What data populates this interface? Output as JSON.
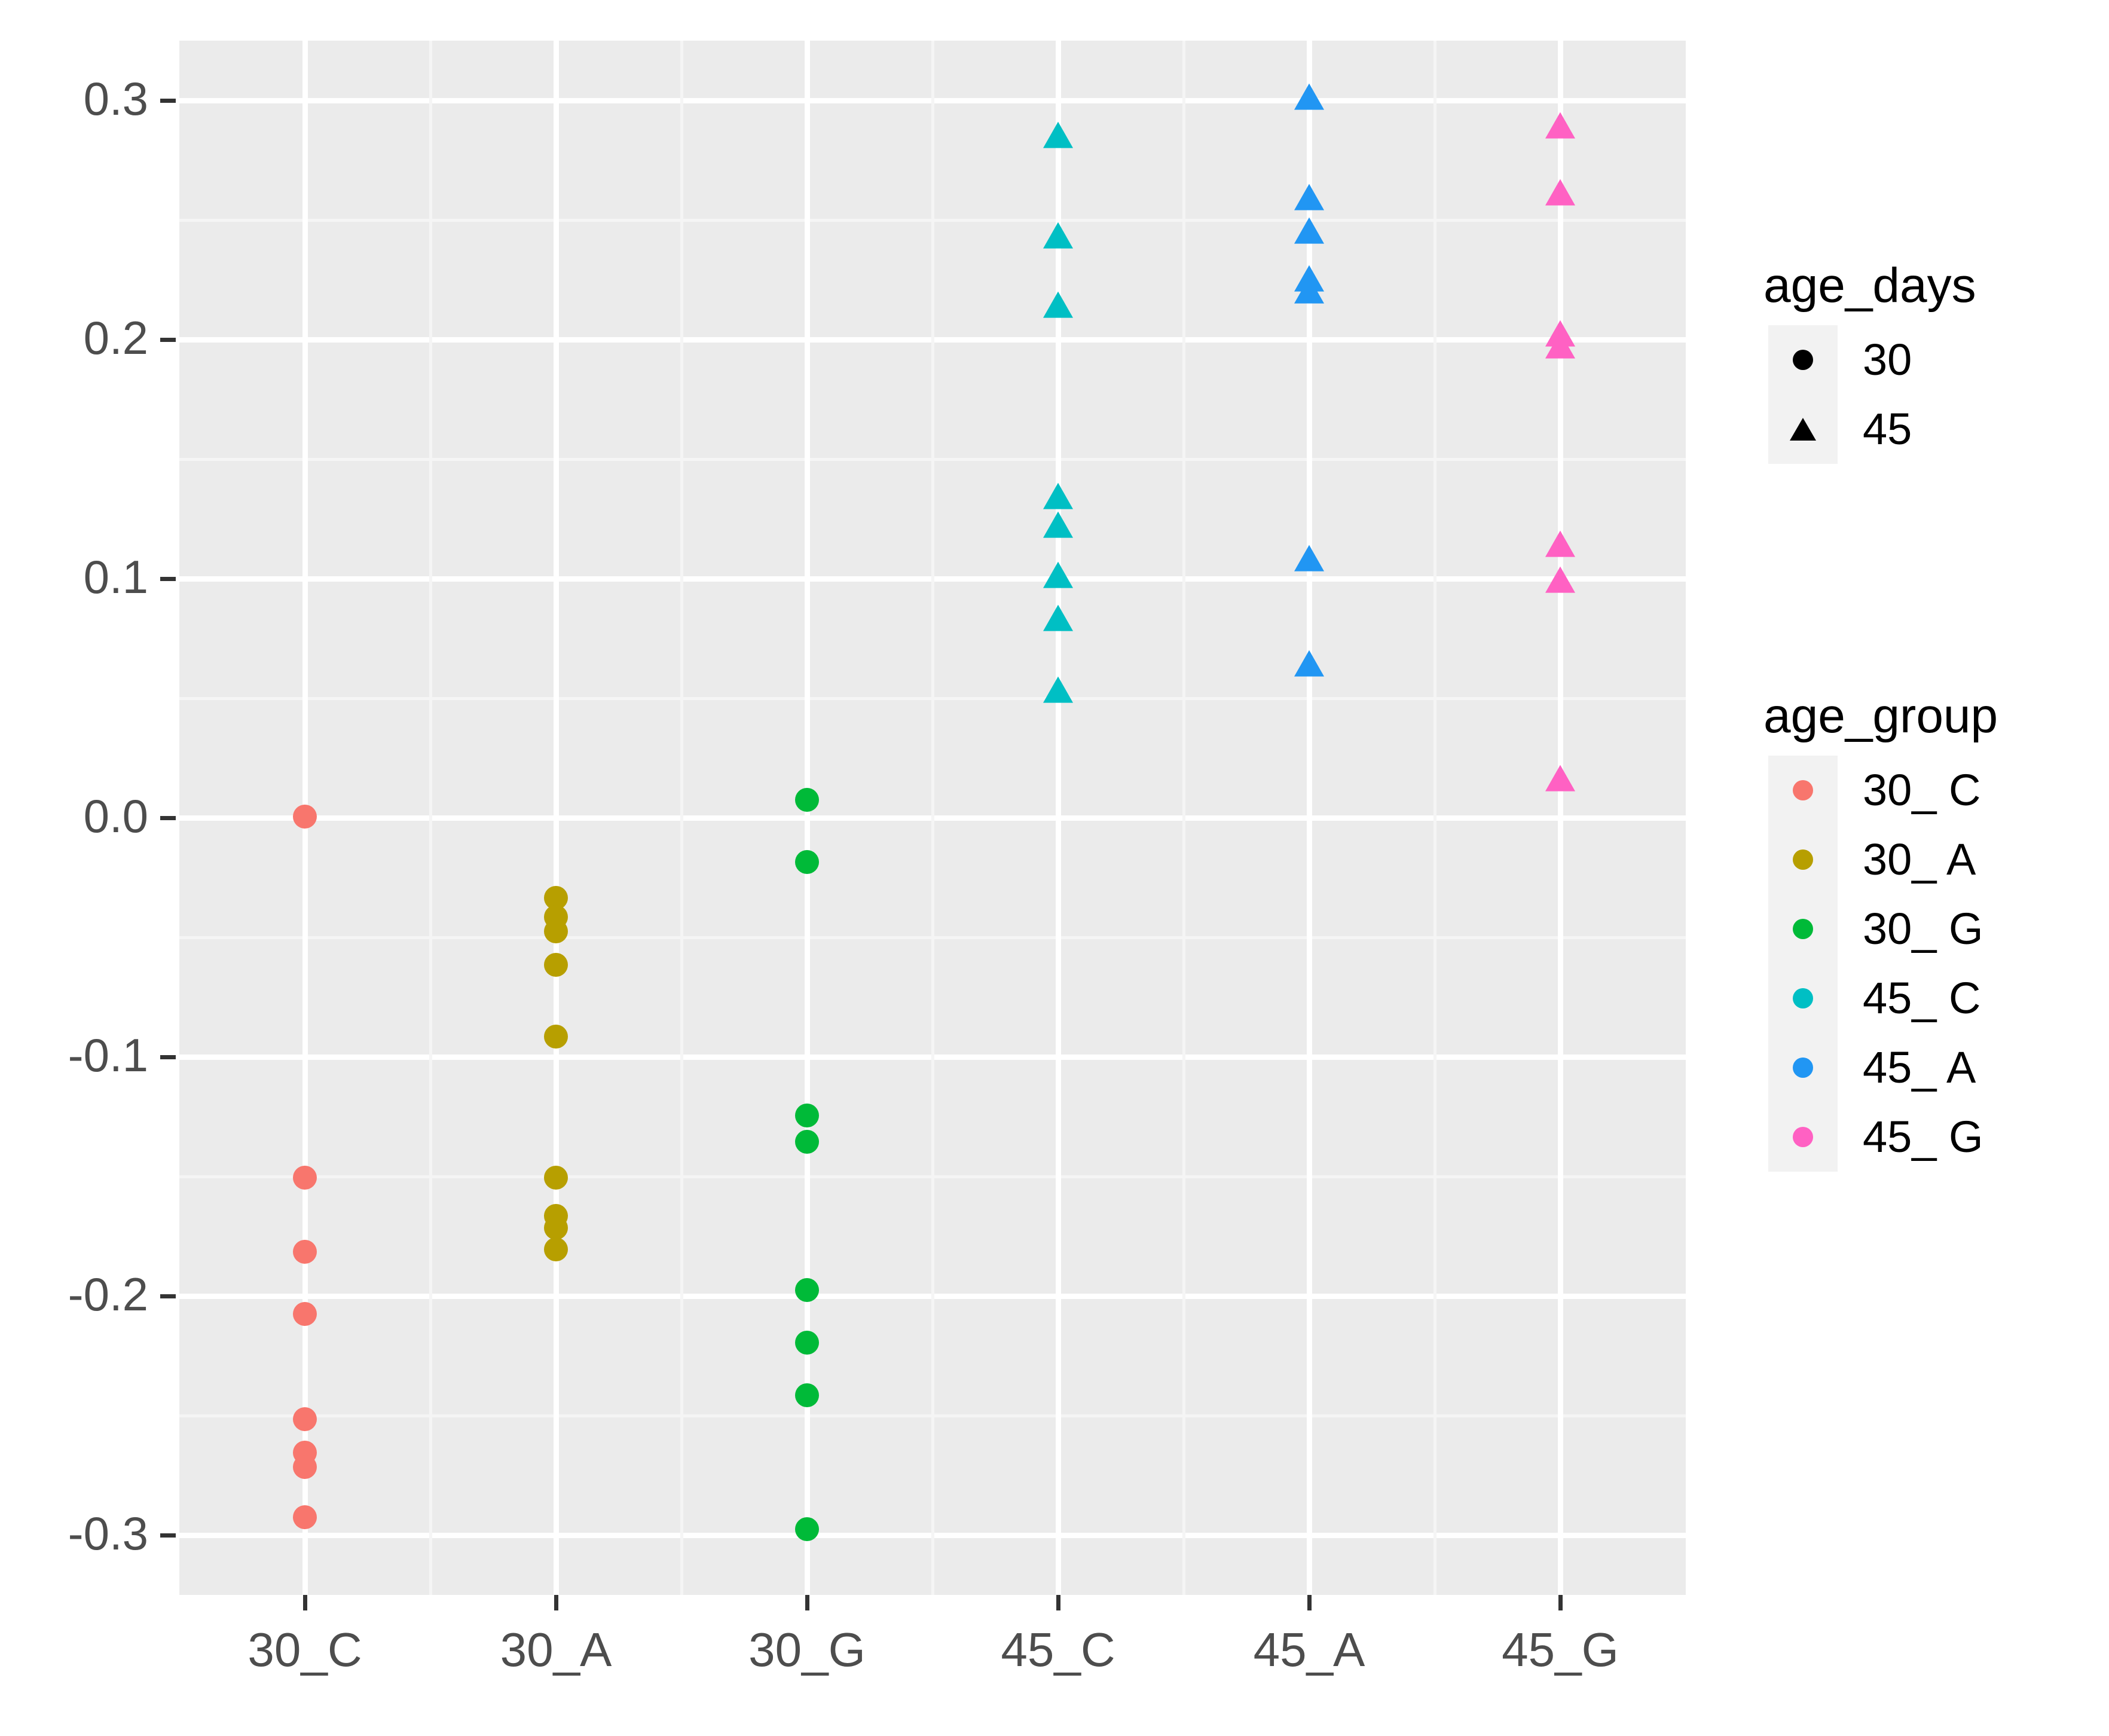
{
  "chart_data": {
    "type": "scatter",
    "title": "",
    "xlabel": "",
    "ylabel": "",
    "categories": [
      "30_C",
      "30_A",
      "30_G",
      "45_C",
      "45_A",
      "45_G"
    ],
    "ylim": [
      -0.325,
      0.325
    ],
    "yticks": [
      0.3,
      0.2,
      0.1,
      0.0,
      -0.1,
      -0.2,
      -0.3
    ],
    "ytick_labels": [
      "0.3",
      "0.2",
      "0.1",
      "0.0",
      "-0.1",
      "-0.2",
      "-0.3"
    ],
    "grid": true,
    "panel_background": "#ebebeb",
    "gridline_color": "#ffffff",
    "legend_position": "right",
    "series": [
      {
        "name": "30_ C",
        "category": "30_C",
        "shape": "circle",
        "age_days": 30,
        "color": "#f8766d",
        "values": [
          0.0005,
          -0.1505,
          -0.1815,
          -0.2075,
          -0.2515,
          -0.2655,
          -0.2715,
          -0.2925
        ]
      },
      {
        "name": "30_ A",
        "category": "30_A",
        "shape": "circle",
        "age_days": 30,
        "color": "#b79f00",
        "values": [
          -0.0335,
          -0.0415,
          -0.0475,
          -0.0615,
          -0.0915,
          -0.1505,
          -0.1665,
          -0.1715,
          -0.1805
        ]
      },
      {
        "name": "30_ G",
        "category": "30_G",
        "shape": "circle",
        "age_days": 30,
        "color": "#00ba38",
        "values": [
          0.0075,
          -0.0185,
          -0.1245,
          -0.1355,
          -0.1975,
          -0.2195,
          -0.2415,
          -0.2975
        ]
      },
      {
        "name": "45_ C",
        "category": "45_C",
        "shape": "triangle",
        "age_days": 45,
        "color": "#00bfc4",
        "values": [
          0.2845,
          0.2425,
          0.2135,
          0.1335,
          0.1215,
          0.1005,
          0.0825,
          0.0525
        ]
      },
      {
        "name": "45_ A",
        "category": "45_A",
        "shape": "triangle",
        "age_days": 45,
        "color": "#2196f3",
        "values": [
          0.3005,
          0.2585,
          0.2445,
          0.2245,
          0.2195,
          0.1075,
          0.0635
        ]
      },
      {
        "name": "45_ G",
        "category": "45_G",
        "shape": "triangle",
        "age_days": 45,
        "color": "#ff61c3",
        "values": [
          0.2885,
          0.2605,
          0.2015,
          0.1965,
          0.1135,
          0.0985,
          0.0155
        ]
      }
    ]
  },
  "legends": [
    {
      "id": "age_days",
      "title": "age_days",
      "items": [
        {
          "label": "30",
          "shape": "circle",
          "color": "#000000"
        },
        {
          "label": "45",
          "shape": "triangle",
          "color": "#000000"
        }
      ]
    },
    {
      "id": "age_group",
      "title": "age_group",
      "items": [
        {
          "label": "30_ C",
          "shape": "circle",
          "color": "#f8766d"
        },
        {
          "label": "30_ A",
          "shape": "circle",
          "color": "#b79f00"
        },
        {
          "label": "30_ G",
          "shape": "circle",
          "color": "#00ba38"
        },
        {
          "label": "45_ C",
          "shape": "circle",
          "color": "#00bfc4"
        },
        {
          "label": "45_ A",
          "shape": "circle",
          "color": "#2196f3"
        },
        {
          "label": "45_ G",
          "shape": "circle",
          "color": "#ff61c3"
        }
      ]
    }
  ]
}
